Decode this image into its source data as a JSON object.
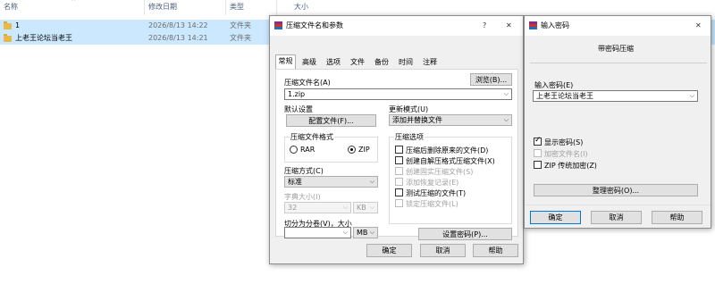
{
  "explorer": {
    "columns": [
      "名称",
      "修改日期",
      "类型",
      "大小"
    ],
    "rows": [
      {
        "name": "1",
        "date": "2026/8/13 14:22",
        "type": "文件夹"
      },
      {
        "name": "上老王论坛当老王",
        "date": "2026/8/13 14:21",
        "type": "文件夹"
      }
    ]
  },
  "archive_dialog": {
    "title": "压缩文件名和参数",
    "help": "?",
    "close": "✕",
    "tabs": [
      "常规",
      "高级",
      "选项",
      "文件",
      "备份",
      "时间",
      "注释"
    ],
    "archive_name_label": "压缩文件名(A)",
    "browse_button": "浏览(B)...",
    "archive_name_value": "1.zip",
    "default_settings_label": "默认设置",
    "profiles_button": "配置文件(F)...",
    "update_mode_label": "更新模式(U)",
    "update_mode_value": "添加并替换文件",
    "format_group": "压缩文件格式",
    "format_rar": "RAR",
    "format_zip": "ZIP",
    "method_label": "压缩方式(C)",
    "method_value": "标准",
    "dict_label": "字典大小(I)",
    "dict_value": "32",
    "dict_unit": "KB",
    "split_label": "切分为分卷(V)，大小",
    "split_unit": "MB",
    "options_group": "压缩选项",
    "options": [
      {
        "label": "压缩后删除原来的文件(D)",
        "checked": false,
        "disabled": false
      },
      {
        "label": "创建自解压格式压缩文件(X)",
        "checked": false,
        "disabled": false
      },
      {
        "label": "创建固实压缩文件(S)",
        "checked": false,
        "disabled": true
      },
      {
        "label": "添加恢复记录(E)",
        "checked": false,
        "disabled": true
      },
      {
        "label": "测试压缩的文件(T)",
        "checked": false,
        "disabled": false
      },
      {
        "label": "锁定压缩文件(L)",
        "checked": false,
        "disabled": true
      }
    ],
    "set_password_button": "设置密码(P)...",
    "ok": "确定",
    "cancel": "取消",
    "help_button": "帮助"
  },
  "password_dialog": {
    "title": "输入密码",
    "close": "✕",
    "subtitle": "带密码压缩",
    "password_label": "输入密码(E)",
    "password_value": "上老王论坛当老王",
    "show_password": "显示密码(S)",
    "encrypt_names": "加密文件名(I)",
    "zip_legacy": "ZIP 传统加密(Z)",
    "organize_button": "整理密码(O)...",
    "ok": "确定",
    "cancel": "取消",
    "help_button": "帮助"
  }
}
